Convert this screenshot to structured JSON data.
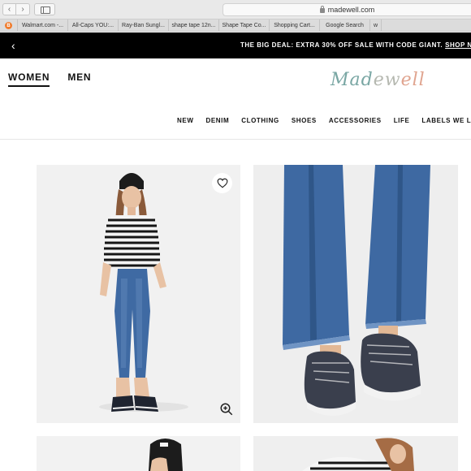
{
  "browser": {
    "url_text": "madewell.com",
    "back_glyph": "‹",
    "forward_glyph": "›",
    "tabs": [
      {
        "label": "Walmart.com -..."
      },
      {
        "label": "All-Caps YOU:..."
      },
      {
        "label": "Ray-Ban Sungl..."
      },
      {
        "label": "shape tape 12n..."
      },
      {
        "label": "Shape Tape Co..."
      },
      {
        "label": "Shopping Cart..."
      },
      {
        "label": "Google Search"
      },
      {
        "label": "w"
      }
    ]
  },
  "promo": {
    "back_glyph": "‹",
    "text": "THE BIG DEAL: EXTRA 30% OFF SALE WITH CODE GIANT.",
    "link": "SHOP NOW"
  },
  "header": {
    "genders": [
      "WOMEN",
      "MEN"
    ],
    "logo": "Madewell",
    "categories": [
      "NEW",
      "DENIM",
      "CLOTHING",
      "SHOES",
      "ACCESSORIES",
      "LIFE",
      "LABELS WE LO"
    ]
  },
  "colors": {
    "logo_teal": "#7aa7a4",
    "logo_gray": "#b5b8b0",
    "logo_peach": "#e0a48f",
    "denim": "#3f6aa3",
    "promo_bg": "#000000"
  },
  "icons": {
    "favorite": "heart-icon",
    "zoom": "zoom-in-icon",
    "lock": "lock-icon",
    "sidebar": "sidebar-icon"
  }
}
